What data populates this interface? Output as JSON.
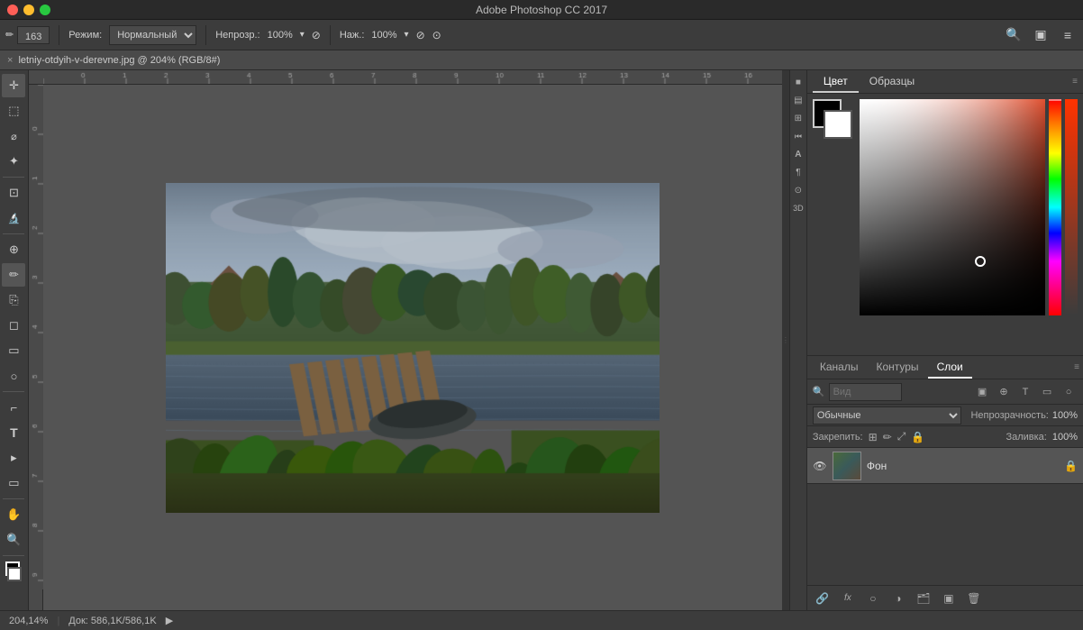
{
  "titlebar": {
    "title": "Adobe Photoshop CC 2017",
    "window_controls": {
      "close": "close",
      "minimize": "minimize",
      "maximize": "maximize"
    }
  },
  "toolbar": {
    "brush_icon": "✏",
    "brush_size_label": "163",
    "mode_label": "Режим:",
    "mode_value": "Нормальный",
    "opacity_label": "Непрозр.:",
    "opacity_value": "100%",
    "check_icon1": "✓",
    "pressure_label": "Наж.:",
    "pressure_value": "100%",
    "check_icon2": "✓",
    "search_icon": "🔍",
    "window_icon": "▣",
    "menu_icon": "≡"
  },
  "document": {
    "tab_label": "letniy-otdyih-v-derevne.jpg @ 204% (RGB/8#)",
    "close": "×"
  },
  "tools": [
    {
      "name": "move",
      "icon": "✛"
    },
    {
      "name": "marquee",
      "icon": "⬚"
    },
    {
      "name": "lasso",
      "icon": "⌀"
    },
    {
      "name": "magic-wand",
      "icon": "✦"
    },
    {
      "name": "crop",
      "icon": "⊡"
    },
    {
      "name": "eyedropper",
      "icon": "🔬"
    },
    {
      "name": "healing",
      "icon": "⊕"
    },
    {
      "name": "brush",
      "icon": "✏",
      "active": true
    },
    {
      "name": "clone",
      "icon": "⎘"
    },
    {
      "name": "eraser",
      "icon": "◻"
    },
    {
      "name": "gradient",
      "icon": "▭"
    },
    {
      "name": "dodge",
      "icon": "○"
    },
    {
      "name": "pen",
      "icon": "⌐"
    },
    {
      "name": "type",
      "icon": "T"
    },
    {
      "name": "path-select",
      "icon": "▸"
    },
    {
      "name": "shape",
      "icon": "▭"
    },
    {
      "name": "hand",
      "icon": "✋"
    },
    {
      "name": "zoom",
      "icon": "🔍"
    },
    {
      "name": "fg-bg",
      "icon": "◼"
    }
  ],
  "right_iconbar": [
    {
      "name": "color-picker-icon",
      "icon": "■"
    },
    {
      "name": "gradient-icon",
      "icon": "▤"
    },
    {
      "name": "pattern-icon",
      "icon": "⊞"
    },
    {
      "name": "history-icon",
      "icon": "⏮"
    },
    {
      "name": "type-tool-icon",
      "icon": "A"
    },
    {
      "name": "paragraph-icon",
      "icon": "¶"
    },
    {
      "name": "clone-source-icon",
      "icon": "⊙"
    },
    {
      "name": "3d-icon",
      "icon": "3"
    }
  ],
  "color_panel": {
    "tabs": [
      "Цвет",
      "Образцы"
    ],
    "active_tab": "Цвет",
    "menu_icon": "≡",
    "foreground_color": "#000000",
    "background_color": "#ffffff"
  },
  "layers_panel": {
    "tabs": [
      "Каналы",
      "Контуры",
      "Слои"
    ],
    "active_tab": "Слои",
    "menu_icon": "≡",
    "search_placeholder": "Вид",
    "blend_mode": "Обычные",
    "opacity_label": "Непрозрачность:",
    "opacity_value": "100%",
    "lock_label": "Закрепить:",
    "fill_label": "Заливка:",
    "fill_value": "100%",
    "layers": [
      {
        "name": "Фон",
        "visible": true,
        "locked": true,
        "thumb": "landscape"
      }
    ],
    "toolbar_icons": [
      "🔍",
      "▣",
      "T",
      "▭",
      "○"
    ],
    "bottom_icons": [
      "🔗",
      "fx",
      "○",
      "▣",
      "🗂",
      "🗑"
    ]
  },
  "statusbar": {
    "zoom": "204,14%",
    "doc_size": "Док: 586,1K/586,1K",
    "arrow": "▶"
  }
}
